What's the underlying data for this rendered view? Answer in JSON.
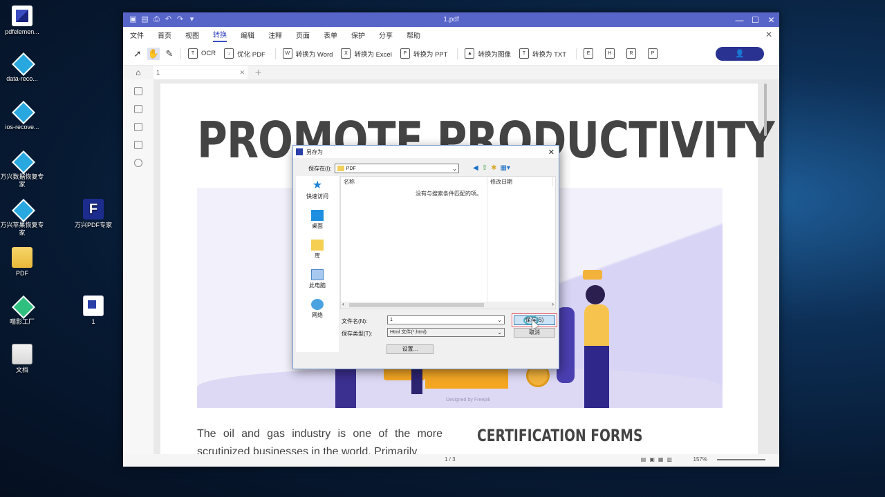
{
  "desktop": {
    "icons": [
      {
        "label": "pdfelemen...",
        "icon": "pdfelement-icon"
      },
      {
        "label": "data-reco...",
        "icon": "data-recovery-icon"
      },
      {
        "label": "ios-recove...",
        "icon": "ios-recovery-icon"
      },
      {
        "label": "万兴数据恢复专家",
        "icon": "data-recovery-icon"
      },
      {
        "label": "万兴苹果恢复专家",
        "icon": "ios-recovery-icon"
      },
      {
        "label": "万兴PDF专家",
        "icon": "pdf-expert-icon"
      },
      {
        "label": "PDF",
        "icon": "folder-icon"
      },
      {
        "label": "喵影工厂",
        "icon": "filmora-icon"
      },
      {
        "label": "1",
        "icon": "pdf-file-icon"
      },
      {
        "label": "文档",
        "icon": "archive-icon"
      }
    ]
  },
  "window": {
    "title": "1.pdf",
    "controls": [
      "—",
      "☐",
      "✕"
    ]
  },
  "menu": {
    "items": [
      "文件",
      "首页",
      "视图",
      "转换",
      "编辑",
      "注释",
      "页面",
      "表单",
      "保护",
      "分享",
      "帮助"
    ],
    "active": "转换"
  },
  "toolbar": {
    "ocr": "OCR",
    "optimize": "优化 PDF",
    "to_word": "转换为 Word",
    "to_excel": "转换为 Excel",
    "to_ppt": "转换为 PPT",
    "to_image": "转换为图像",
    "to_txt": "转换为 TXT"
  },
  "tabs": [
    {
      "label": "1"
    }
  ],
  "document": {
    "headline": "PROMOTE PRODUCTIVITY",
    "credit": "Designed by Freepik",
    "body": "The oil and gas industry is one of the more scrutinized businesses in the world. Primarily",
    "subheading": "CERTIFICATION FORMS"
  },
  "status": {
    "page": "1 / 3",
    "zoom": "157%"
  },
  "dialog": {
    "title": "另存为",
    "save_in_label": "保存在(I):",
    "save_in_value": "PDF",
    "places": [
      {
        "label": "快速访问",
        "icon": "star-icon"
      },
      {
        "label": "桌面",
        "icon": "desktop-icon"
      },
      {
        "label": "库",
        "icon": "library-icon"
      },
      {
        "label": "此电脑",
        "icon": "computer-icon"
      },
      {
        "label": "网络",
        "icon": "network-icon"
      }
    ],
    "col_name": "名称",
    "col_modified": "修改日期",
    "empty_message": "没有与搜索条件匹配的项。",
    "filename_label": "文件名(N):",
    "filename_value": "1",
    "filetype_label": "保存类型(T):",
    "filetype_value": "Html 文件(*.html)",
    "settings_button": "设置...",
    "save_button": "保存(S)",
    "cancel_button": "取消"
  }
}
